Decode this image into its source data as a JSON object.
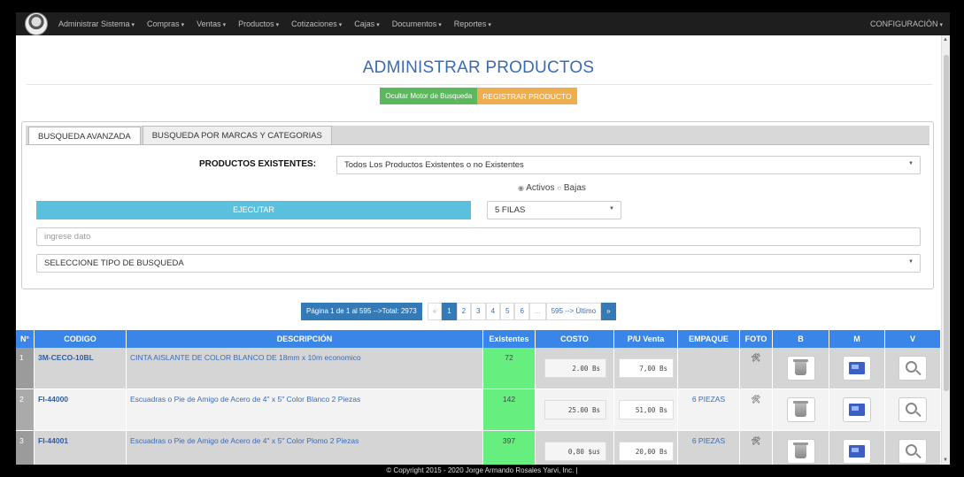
{
  "navbar": {
    "menus": [
      "Administrar Sistema",
      "Compras",
      "Ventas",
      "Productos",
      "Cotizaciones",
      "Cajas",
      "Documentos",
      "Reportes"
    ],
    "config": "CONFIGURACIÓN"
  },
  "page": {
    "title": "ADMINISTRAR PRODUCTOS",
    "hide_search_button": "Ocultar Motor de Busqueda",
    "register_button": "REGISTRAR PRODUCTO"
  },
  "search": {
    "tabs": [
      "BUSQUEDA AVANZADA",
      "BUSQUEDA POR MARCAS Y CATEGORIAS"
    ],
    "existing_label": "PRODUCTOS EXISTENTES:",
    "existing_value": "Todos Los Productos Existentes o no Existentes",
    "radio_active": "Activos",
    "radio_low": "Bajas",
    "execute_button": "EJECUTAR",
    "rows_value": "5 FILAS",
    "input_placeholder": "ingrese dato",
    "search_type_value": "SELECCIONE TIPO DE BUSQUEDA"
  },
  "pagination": {
    "info": "Página 1 de 1 al 595 -->Total: 2973",
    "prev": "«",
    "pages": [
      "1",
      "2",
      "3",
      "4",
      "5",
      "6",
      "..."
    ],
    "last": "595 --> Último",
    "next": "»"
  },
  "table": {
    "headers": [
      "N°",
      "CODIGO",
      "DESCRIPCIÓN",
      "Existentes",
      "COSTO",
      "P/U Venta",
      "EMPAQUE",
      "FOTO",
      "B",
      "M",
      "V"
    ],
    "rows": [
      {
        "num": "1",
        "code": "3M-CECO-10BL",
        "desc": "CINTA AISLANTE DE COLOR BLANCO DE 18mm x 10m economico",
        "exist": "72",
        "cost": "2.00 Bs",
        "price": "7,00 Bs",
        "pack": ""
      },
      {
        "num": "2",
        "code": "FI-44000",
        "desc": "Escuadras o Pie de Amigo de Acero de 4\" x 5\" Color Blanco 2 Piezas",
        "exist": "142",
        "cost": "25.00 Bs",
        "price": "51,00 Bs",
        "pack": "6 PIEZAS"
      },
      {
        "num": "3",
        "code": "FI-44001",
        "desc": "Escuadras o Pie de Amigo de Acero de 4\" x 5\" Color Plomo 2 Piezas",
        "exist": "397",
        "cost": "0,80 $us",
        "price": "20,00 Bs",
        "pack": "6 PIEZAS"
      }
    ]
  },
  "footer": "© Copyright 2015 - 2020 Jorge Armando Rosales Yarvi, Inc. |",
  "colors": {
    "navbar": "#1e1e1e",
    "title": "#3a6bb7",
    "green": "#5cb85c",
    "orange": "#f0ad4e",
    "info": "#5bc0de",
    "table_header": "#3a86e8",
    "existing": "#66ef7f"
  }
}
